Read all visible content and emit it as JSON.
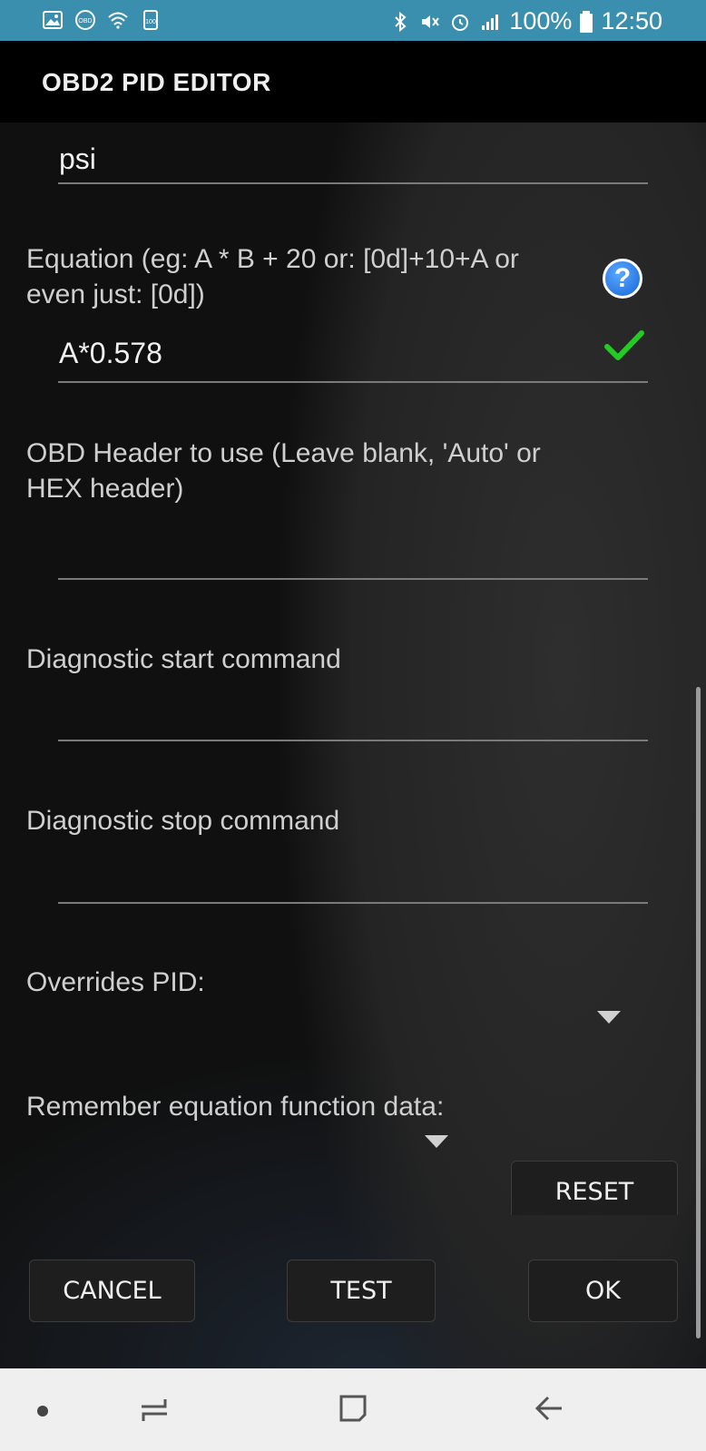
{
  "status_bar": {
    "battery_percent": "100%",
    "time": "12:50",
    "left_icons": [
      "image-icon",
      "obd-icon",
      "wifi-icon",
      "battery-100-icon"
    ],
    "right_icons": [
      "bluetooth-icon",
      "mute-icon",
      "alarm-icon",
      "signal-icon"
    ],
    "background": "#3a8fae"
  },
  "app_bar": {
    "title": "OBD2 PID EDITOR"
  },
  "form": {
    "units_value": "psi",
    "equation_label": "Equation (eg:  A * B + 20   or: [0d]+10+A or even just: [0d])",
    "equation_value": "A*0.578",
    "header_label": "OBD Header to use (Leave blank, 'Auto' or HEX header)",
    "header_value": "",
    "diag_start_label": "Diagnostic start command",
    "diag_start_value": "",
    "diag_stop_label": "Diagnostic stop command",
    "diag_stop_value": "",
    "overrides_label": "Overrides PID:",
    "overrides_value": "",
    "remember_label": "Remember equation function data:",
    "remember_value": ""
  },
  "buttons": {
    "reset": "RESET",
    "cancel": "CANCEL",
    "test": "TEST",
    "ok": "OK"
  },
  "colors": {
    "help_icon": "#1766d8",
    "valid_check": "#22cc22"
  },
  "nav_bar": {
    "icons": [
      "dot-icon",
      "recent-apps-icon",
      "home-icon",
      "back-icon"
    ]
  }
}
